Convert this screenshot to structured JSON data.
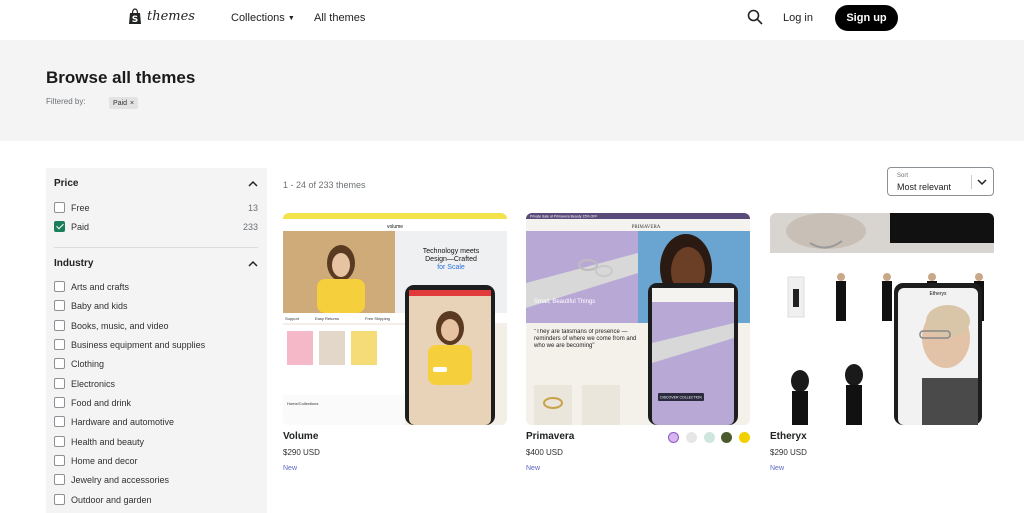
{
  "header": {
    "logo_text": "themes",
    "nav": [
      {
        "label": "Collections",
        "has_dropdown": true
      },
      {
        "label": "All themes",
        "has_dropdown": false
      }
    ],
    "login_label": "Log in",
    "signup_label": "Sign up",
    "icons": {
      "search": "search-icon",
      "logo": "shopify-bag-icon"
    }
  },
  "banner": {
    "title": "Browse all themes",
    "filtered_by_label": "Filtered by:",
    "active_filters": [
      {
        "label": "Paid",
        "remove_icon": "close-icon"
      }
    ]
  },
  "sidebar": {
    "price": {
      "heading": "Price",
      "options": [
        {
          "label": "Free",
          "count": "13",
          "checked": false
        },
        {
          "label": "Paid",
          "count": "233",
          "checked": true
        }
      ]
    },
    "industry": {
      "heading": "Industry",
      "options": [
        {
          "label": "Arts and crafts",
          "checked": false
        },
        {
          "label": "Baby and kids",
          "checked": false
        },
        {
          "label": "Books, music, and video",
          "checked": false
        },
        {
          "label": "Business equipment and supplies",
          "checked": false
        },
        {
          "label": "Clothing",
          "checked": false
        },
        {
          "label": "Electronics",
          "checked": false
        },
        {
          "label": "Food and drink",
          "checked": false
        },
        {
          "label": "Hardware and automotive",
          "checked": false
        },
        {
          "label": "Health and beauty",
          "checked": false
        },
        {
          "label": "Home and decor",
          "checked": false
        },
        {
          "label": "Jewelry and accessories",
          "checked": false
        },
        {
          "label": "Outdoor and garden",
          "checked": false
        }
      ]
    }
  },
  "results": {
    "count_text": "1 - 24 of 233 themes",
    "sort": {
      "label": "Sort",
      "value": "Most relevant"
    }
  },
  "themes": [
    {
      "name": "Volume",
      "price": "$290 USD",
      "badge": "New",
      "preview": {
        "brand": "volume",
        "headline_1": "Technology meets",
        "headline_2": "Design—Crafted",
        "headline_3": "for Scale",
        "features": [
          "Support",
          "Easy Returns",
          "Free Shipping"
        ],
        "footer_link": "Home/Collections"
      }
    },
    {
      "name": "Primavera",
      "price": "$400 USD",
      "badge": "New",
      "swatches": [
        "#d8b4f0",
        "#e6e6e6",
        "#cfe6df",
        "#4b5a2c",
        "#f2d000"
      ],
      "preview": {
        "brand": "PRIMAVERA",
        "announcement": "Private Sale at Primavera Beauty 15% OFF",
        "heading": "Small, Beautiful Things",
        "quote": "\"They are talismans of presence —reminders of where we come from and who we are becoming\"",
        "cta": "DISCOVER COLLECTION"
      }
    },
    {
      "name": "Etheryx",
      "price": "$290 USD",
      "badge": "New",
      "preview": {
        "brand": "Etheryx"
      }
    }
  ]
}
